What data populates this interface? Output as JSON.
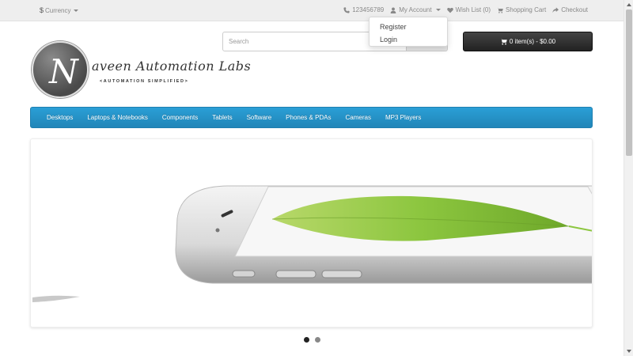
{
  "topbar": {
    "currency_symbol": "$",
    "currency_label": "Currency",
    "phone": "123456789",
    "my_account": "My Account",
    "wishlist": "Wish List (0)",
    "shopping_cart": "Shopping Cart",
    "checkout": "Checkout"
  },
  "account_dropdown": {
    "items": [
      "Register",
      "Login"
    ]
  },
  "logo": {
    "initial": "N",
    "title": "aveen Automation Labs",
    "subtitle": "<AUTOMATION SIMPLIFIED>"
  },
  "search": {
    "placeholder": "Search",
    "value": ""
  },
  "cart": {
    "label": "0 item(s) - $0.00"
  },
  "menu": {
    "items": [
      "Desktops",
      "Laptops & Notebooks",
      "Components",
      "Tablets",
      "Software",
      "Phones & PDAs",
      "Cameras",
      "MP3 Players"
    ]
  },
  "slideshow": {
    "slide_count": 2,
    "active_index": 0
  },
  "colors": {
    "menu_bar": "#2a9fd6",
    "cart_button": "#333333",
    "leaf": "#8cc63f"
  }
}
